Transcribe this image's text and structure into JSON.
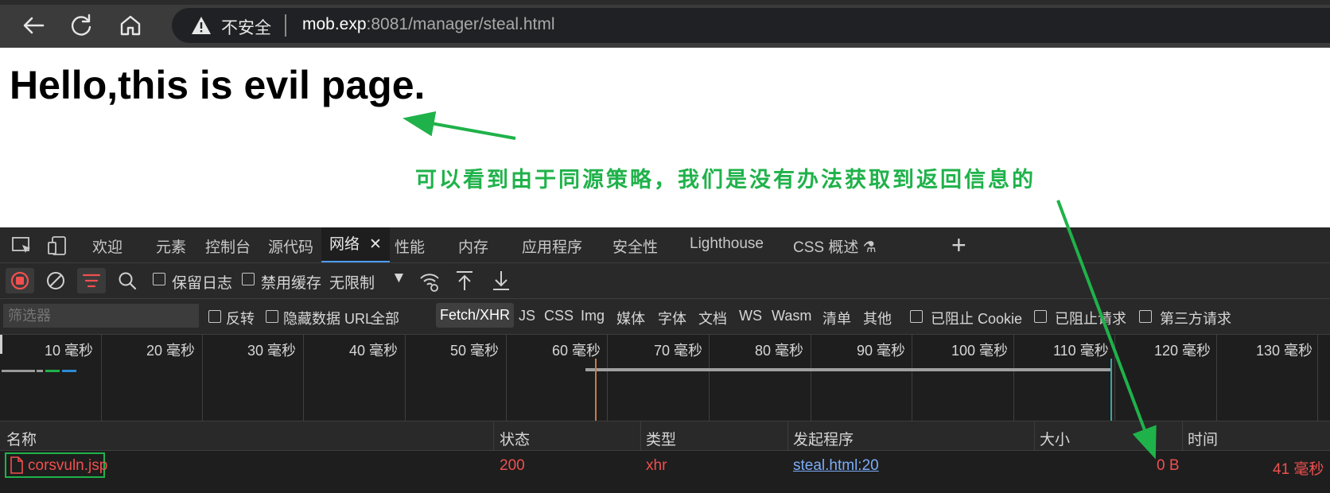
{
  "browser": {
    "insecure_label": "不安全",
    "url_host": "mob.exp",
    "url_rest": ":8081/manager/steal.html"
  },
  "page": {
    "heading": "Hello,this is evil page.",
    "annotation": "可以看到由于同源策略，我们是没有办法获取到返回信息的"
  },
  "devtools": {
    "tabs": [
      "欢迎",
      "元素",
      "控制台",
      "源代码",
      "网络",
      "性能",
      "内存",
      "应用程序",
      "安全性",
      "Lighthouse",
      "CSS 概述"
    ],
    "active_tab": "网络",
    "toolbar": {
      "preserve_log": "保留日志",
      "disable_cache": "禁用缓存",
      "throttle": "无限制"
    },
    "filter": {
      "placeholder": "筛选器",
      "invert": "反转",
      "hide_data_urls": "隐藏数据 URL",
      "types": [
        "全部",
        "Fetch/XHR",
        "JS",
        "CSS",
        "Img",
        "媒体",
        "字体",
        "文档",
        "WS",
        "Wasm",
        "清单",
        "其他"
      ],
      "active_type": "Fetch/XHR",
      "blocked_cookies": "已阻止 Cookie",
      "blocked_requests": "已阻止请求",
      "third_party": "第三方请求"
    },
    "timeline_ticks": [
      "10 毫秒",
      "20 毫秒",
      "30 毫秒",
      "40 毫秒",
      "50 毫秒",
      "60 毫秒",
      "70 毫秒",
      "80 毫秒",
      "90 毫秒",
      "100 毫秒",
      "110 毫秒",
      "120 毫秒",
      "130 毫秒"
    ],
    "columns": [
      "名称",
      "状态",
      "类型",
      "发起程序",
      "大小",
      "时间"
    ],
    "rows": [
      {
        "name": "corsvuln.jsp",
        "status": "200",
        "type": "xhr",
        "initiator": "steal.html:20",
        "size": "0 B",
        "time": "41 毫秒"
      }
    ]
  },
  "colors": {
    "annotation": "#1fb24a",
    "error_text": "#f0504f",
    "link": "#7cacf8"
  }
}
